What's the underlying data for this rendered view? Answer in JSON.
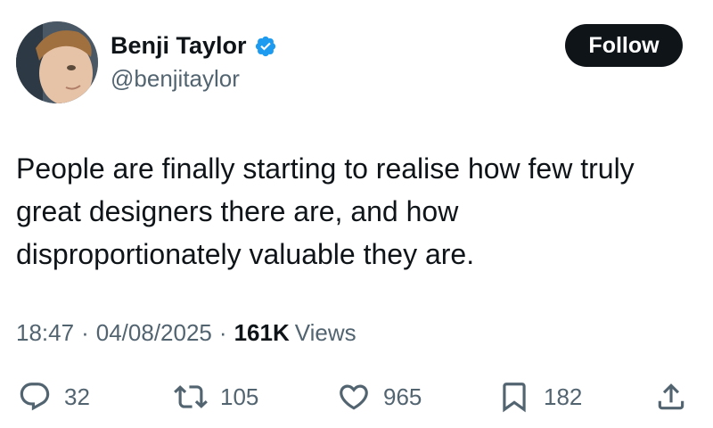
{
  "author": {
    "display_name": "Benji Taylor",
    "handle": "@benjitaylor",
    "verified": true,
    "avatar_icon": "avatar-photo"
  },
  "follow_button": {
    "label": "Follow"
  },
  "tweet": {
    "text": "People are finally starting to realise how few truly\ngreat designers there are, and how\ndisproportionately valuable they are."
  },
  "meta": {
    "time": "18:47",
    "date": "04/08/2025",
    "separator": "·",
    "views_count": "161K",
    "views_label": "Views"
  },
  "actions": {
    "reply": {
      "icon": "reply-icon",
      "count": "32"
    },
    "retweet": {
      "icon": "retweet-icon",
      "count": "105"
    },
    "like": {
      "icon": "heart-icon",
      "count": "965"
    },
    "bookmark": {
      "icon": "bookmark-icon",
      "count": "182"
    },
    "share": {
      "icon": "share-icon"
    }
  },
  "colors": {
    "text_primary": "#0f1419",
    "text_secondary": "#536471",
    "verified_blue": "#1d9bf0",
    "follow_bg": "#0f1419",
    "follow_text": "#ffffff",
    "background": "#ffffff"
  }
}
